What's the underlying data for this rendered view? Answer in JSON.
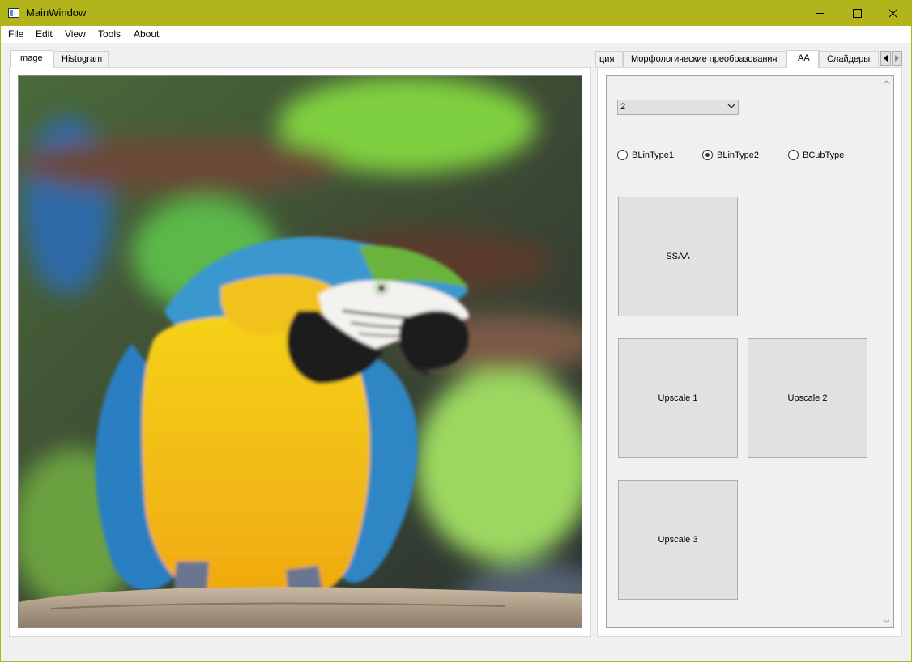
{
  "window": {
    "title": "MainWindow",
    "accent_color": "#b1b41a"
  },
  "menu": [
    "File",
    "Edit",
    "View",
    "Tools",
    "About"
  ],
  "left_tabs": [
    {
      "label": "Image",
      "active": true
    },
    {
      "label": "Histogram",
      "active": false
    }
  ],
  "right_tabs": [
    {
      "label": "ция",
      "active": false
    },
    {
      "label": "Морфологические преобразования",
      "active": false
    },
    {
      "label": "AA",
      "active": true
    },
    {
      "label": "Слайдеры",
      "active": false
    }
  ],
  "aa_panel": {
    "combo_value": "2",
    "radios": [
      {
        "label": "BLinType1",
        "checked": false
      },
      {
        "label": "BLinType2",
        "checked": true
      },
      {
        "label": "BCubType",
        "checked": false
      }
    ],
    "buttons": {
      "ssaa": "SSAA",
      "upscale1": "Upscale 1",
      "upscale2": "Upscale 2",
      "upscale3": "Upscale 3"
    }
  },
  "image": {
    "subject": "macaw-parrot-photo"
  }
}
